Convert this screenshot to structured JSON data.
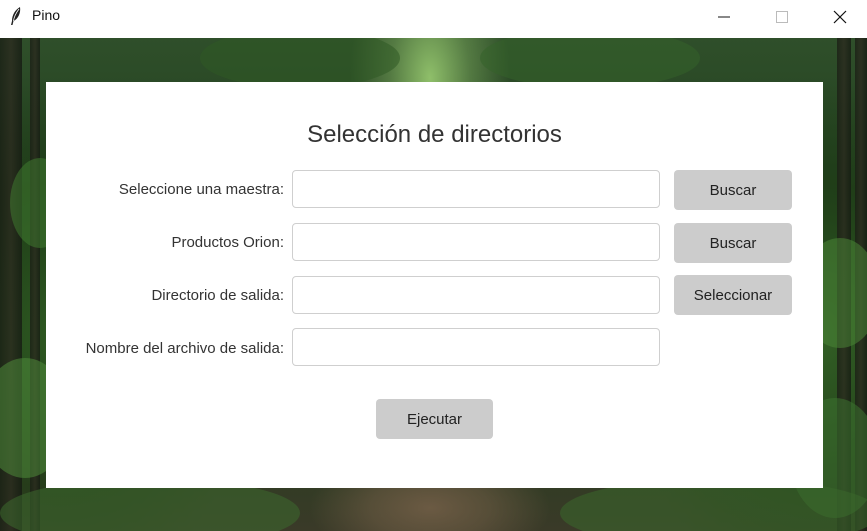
{
  "window": {
    "title": "Pino",
    "icon": "feather-icon",
    "controls": [
      "minimize-icon",
      "maximize-icon",
      "close-icon"
    ]
  },
  "form": {
    "heading": "Selección de directorios",
    "rows": [
      {
        "label": "Seleccione una maestra:",
        "value": "",
        "button": "Buscar"
      },
      {
        "label": "Productos Orion:",
        "value": "",
        "button": "Buscar"
      },
      {
        "label": "Directorio de salida:",
        "value": "",
        "button": "Seleccionar"
      },
      {
        "label": "Nombre del archivo de salida:",
        "value": ""
      }
    ],
    "run_button": "Ejecutar"
  },
  "colors": {
    "panel": "#ffffff",
    "button": "#cccccc",
    "text": "#333333"
  }
}
